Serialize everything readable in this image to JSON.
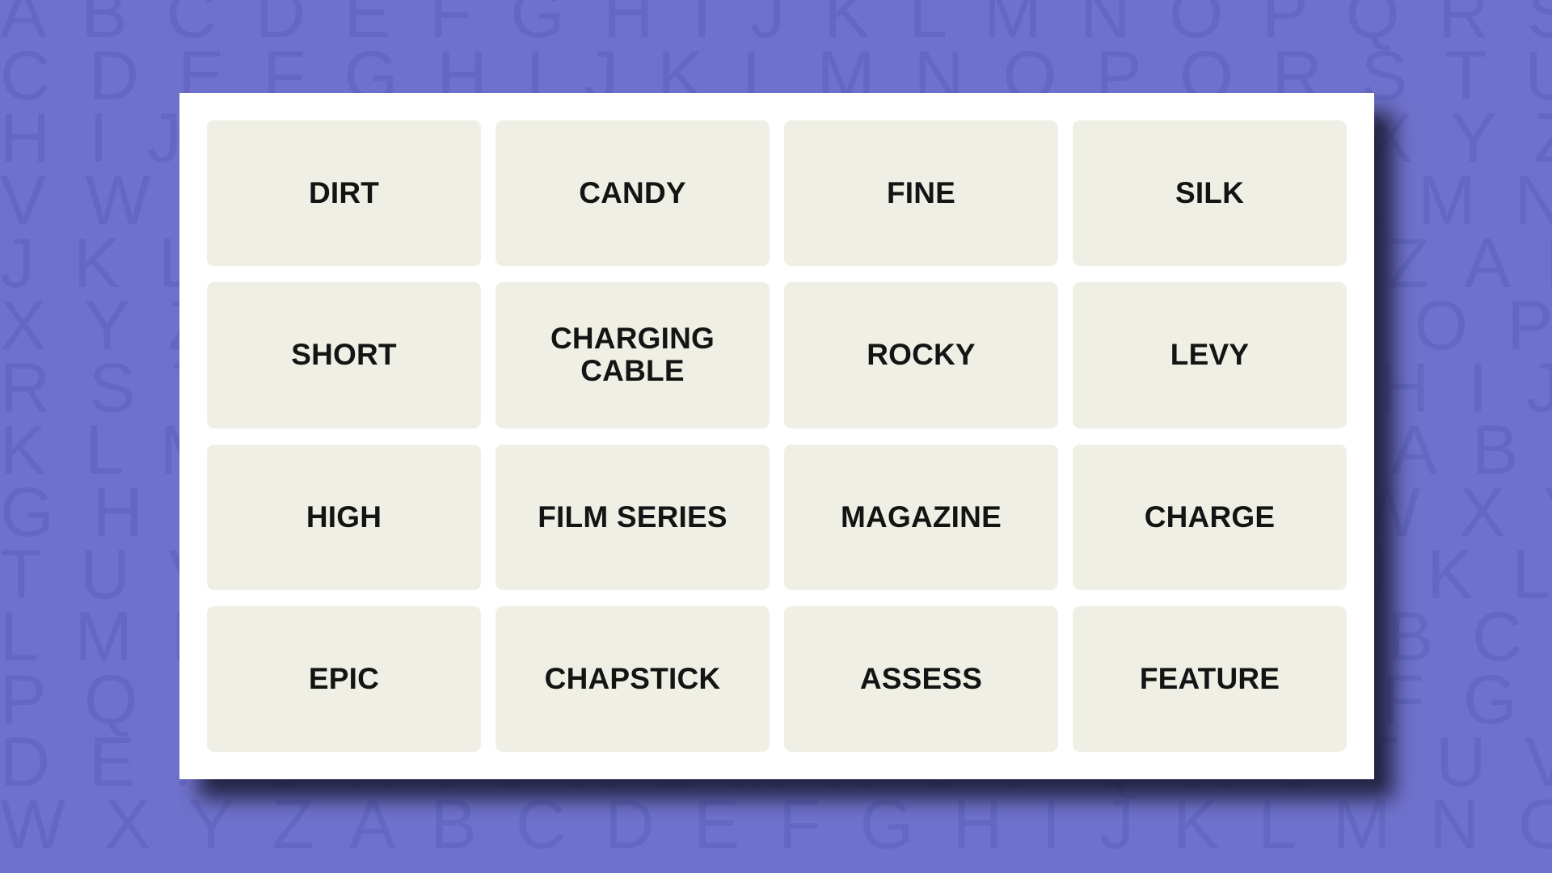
{
  "background": {
    "color": "#6f72cd",
    "letter_color": "#6468c2",
    "alphabet_rows": [
      "A B C D E F G H I J K L M N O P Q R S T U V W X Y Z A B C D E F",
      "C D E F G H I J K L M N O P Q R S T U V W X Y Z A B C D E F G H",
      "H I J K L M N O P Q R S T U V W X Y Z A B C D E F G H I J K L M",
      "V W X Y Z A B C D E F G H I J K L M N O P Q R S T U V W X Y Z A",
      "J K L M N O P Q R S T U V W X Y Z A B C D E F G H I J K L M N O",
      "X Y Z A B C D E F G H I J K L M N O P Q R S T U V W X Y Z A B C",
      "R S T U V W X Y Z A B C D E F G H I J K L M N O P Q R S T U V W",
      "K L M N O P Q R S T U V W X Y Z A B C D E F G H I J K L M N O P",
      "G H I J K L M N O P Q R S T U V W X Y Z A B C D E F G H I J K L",
      "T U V W X Y Z A B C D E F G H I J K L M N O P Q R S T U V W X Y",
      "L M N O P Q R S T U V W X Y Z A B C D E F G H I J K L M N O P Q",
      "P Q R S T U V W X Y Z A B C D E F G H I J K L M N O P Q R S T U",
      "D E F G H I J K L M N O P Q R S T U V W X Y Z A B C D E F G H I",
      "W X Y Z A B C D E F G H I J K L M N O P Q R S T U V W X Y Z A B"
    ]
  },
  "board": {
    "card_color": "#ffffff",
    "tile_color": "#efefe6",
    "tile_text_color": "#141414",
    "rows": 4,
    "columns": 4,
    "tiles": [
      {
        "id": "tile-0-0",
        "label": "DIRT"
      },
      {
        "id": "tile-0-1",
        "label": "CANDY"
      },
      {
        "id": "tile-0-2",
        "label": "FINE"
      },
      {
        "id": "tile-0-3",
        "label": "SILK"
      },
      {
        "id": "tile-1-0",
        "label": "SHORT"
      },
      {
        "id": "tile-1-1",
        "label": "CHARGING\nCABLE"
      },
      {
        "id": "tile-1-2",
        "label": "ROCKY"
      },
      {
        "id": "tile-1-3",
        "label": "LEVY"
      },
      {
        "id": "tile-2-0",
        "label": "HIGH"
      },
      {
        "id": "tile-2-1",
        "label": "FILM SERIES"
      },
      {
        "id": "tile-2-2",
        "label": "MAGAZINE"
      },
      {
        "id": "tile-2-3",
        "label": "CHARGE"
      },
      {
        "id": "tile-3-0",
        "label": "EPIC"
      },
      {
        "id": "tile-3-1",
        "label": "CHAPSTICK"
      },
      {
        "id": "tile-3-2",
        "label": "ASSESS"
      },
      {
        "id": "tile-3-3",
        "label": "FEATURE"
      }
    ]
  }
}
